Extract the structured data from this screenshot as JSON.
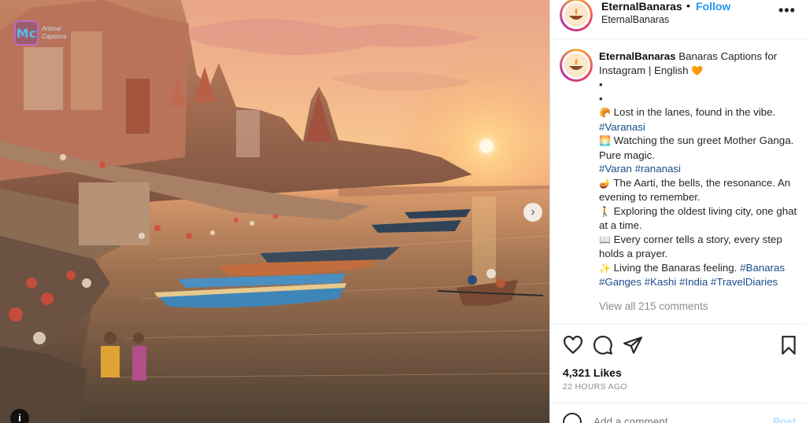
{
  "photo": {
    "watermark_logo": "Mc",
    "watermark_text": "Animal Captions",
    "next_icon": "chevron-right-icon",
    "info_icon": "info-icon",
    "info_glyph": "i",
    "next_glyph": "›"
  },
  "header": {
    "username": "EternalBanaras",
    "separator": "•",
    "follow_label": "Follow",
    "subtitle": "EternalBanaras",
    "more_glyph": "•••"
  },
  "caption": {
    "username": "EternalBanaras",
    "title": "Banaras Captions for Instagram | English",
    "heart": "🧡",
    "bullets": [
      "•",
      "•"
    ],
    "lines": [
      {
        "emoji": "🥐",
        "text": "Lost in the lanes, found in the vibe.",
        "tags": "#Varanasi"
      },
      {
        "emoji": "🌅",
        "text": "Watching the sun greet Mother Ganga. Pure magic.",
        "tags": "#Varan #rananasi"
      },
      {
        "emoji": "🪔",
        "text": "The Aarti, the bells, the resonance. An evening to remember.",
        "tags": ""
      },
      {
        "emoji": "🚶",
        "text": "Exploring the oldest living city, one ghat at a time.",
        "tags": ""
      },
      {
        "emoji": "📖",
        "text": "Every corner tells a story, every step holds a prayer.",
        "tags": ""
      },
      {
        "emoji": "✨",
        "text": "Living the Banaras feeling.",
        "tags": "#Banaras #Ganges #Kashi #India #TravelDiaries"
      }
    ]
  },
  "comments_link": "View all 215 comments",
  "actions": {
    "icons": [
      "heart-icon",
      "comment-icon",
      "share-icon",
      "bookmark-icon"
    ]
  },
  "likes": "4,321 Likes",
  "timestamp": "22 HOURS AGO",
  "comment_box": {
    "placeholder": "Add a comment...",
    "post_label": "Post"
  }
}
